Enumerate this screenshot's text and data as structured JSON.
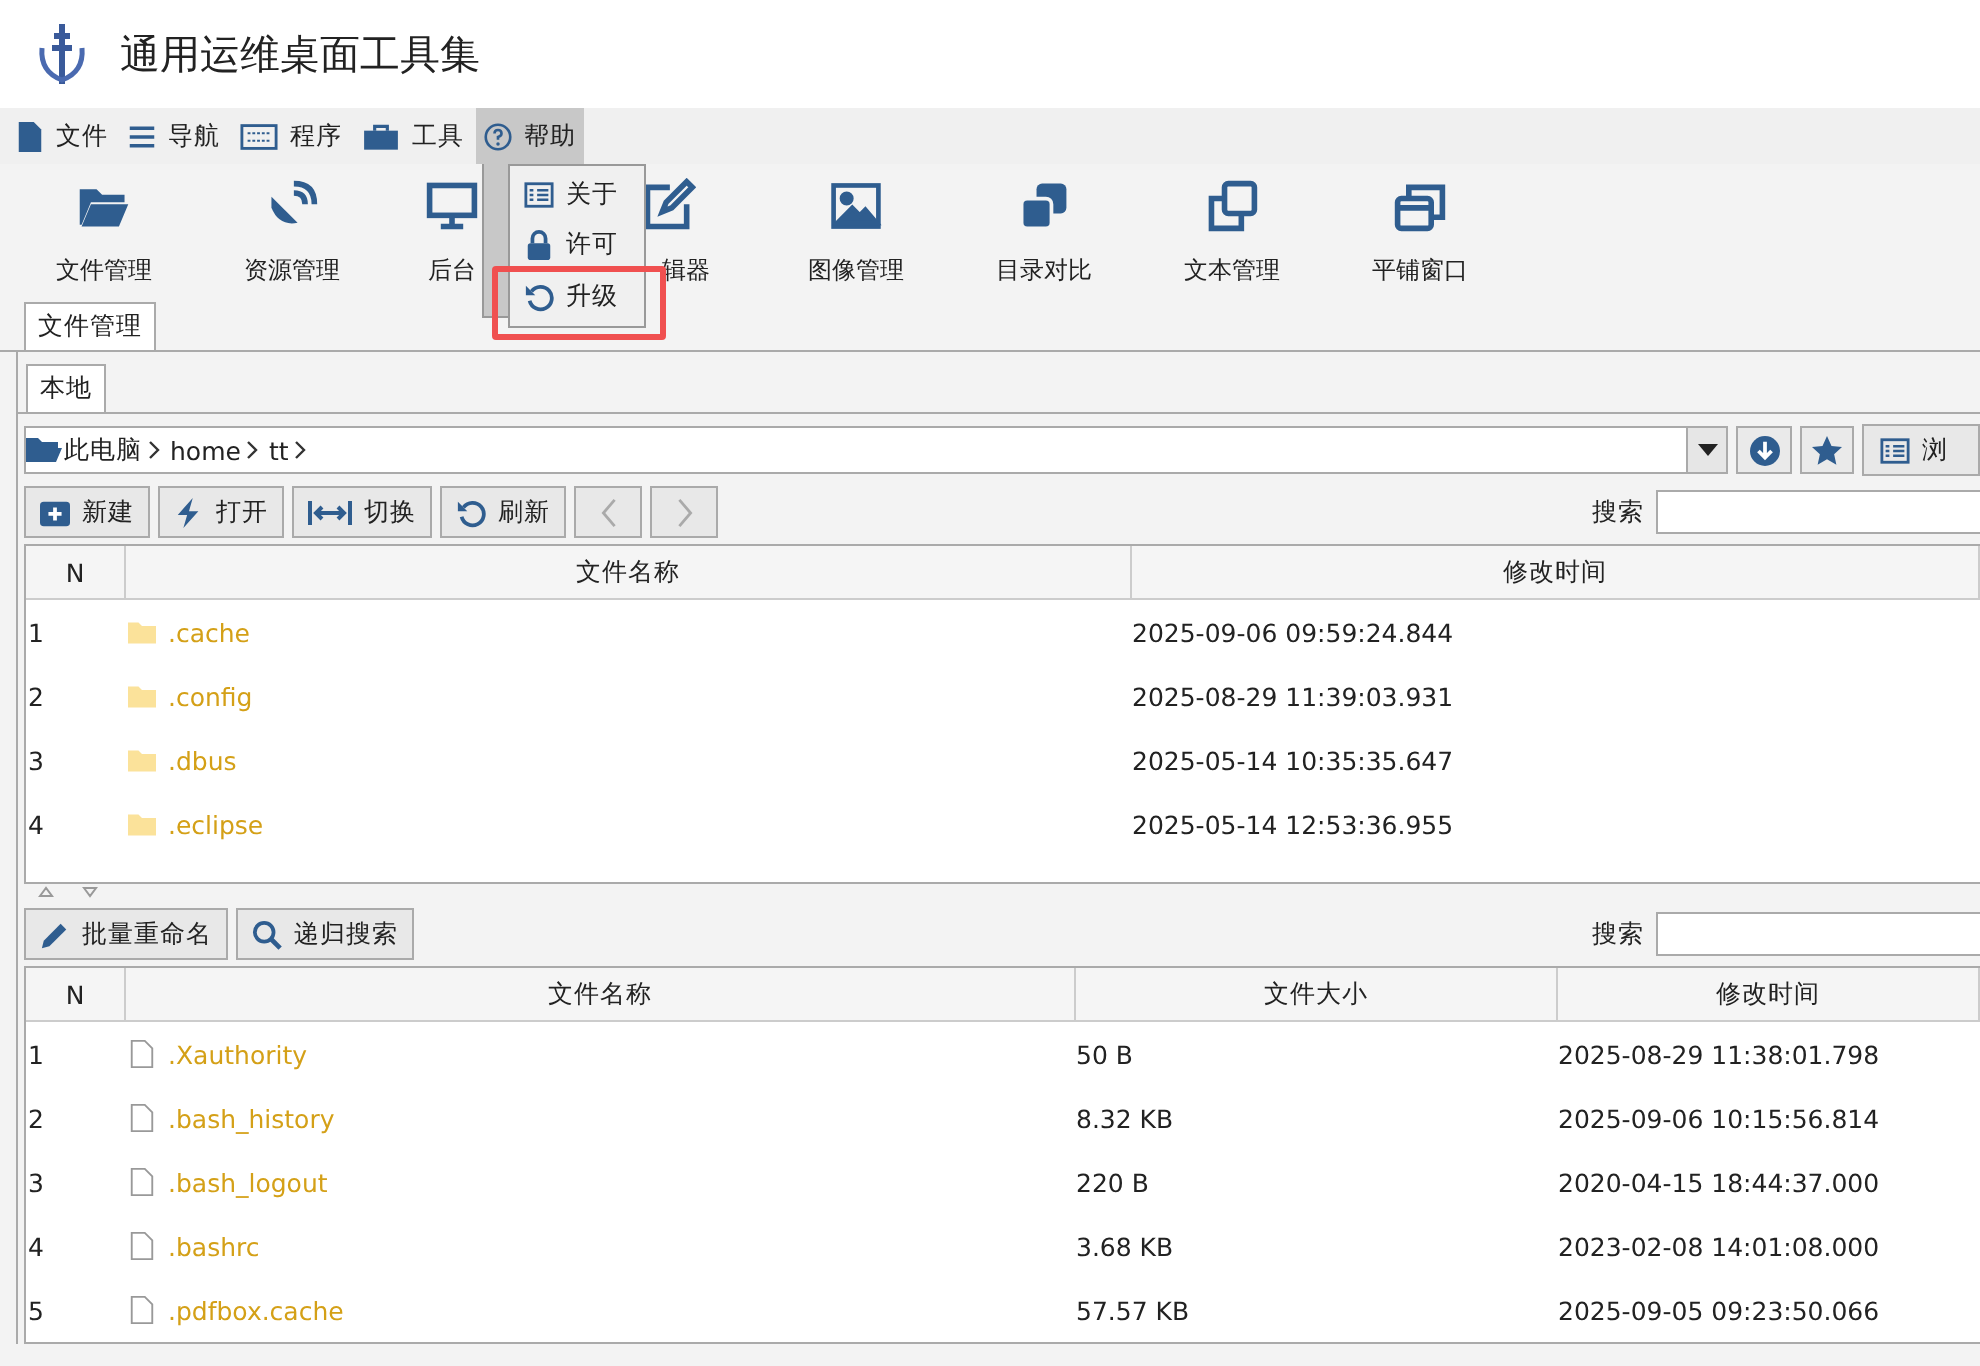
{
  "app_title": "通用运维桌面工具集",
  "menubar": [
    {
      "label": "文件",
      "selected": false
    },
    {
      "label": "导航",
      "selected": false
    },
    {
      "label": "程序",
      "selected": false
    },
    {
      "label": "工具",
      "selected": false
    },
    {
      "label": "帮助",
      "selected": true
    }
  ],
  "help_menu": [
    {
      "label": "关于",
      "annotated": false
    },
    {
      "label": "许可",
      "annotated": false
    },
    {
      "label": "升级",
      "annotated": true
    }
  ],
  "toolbar": [
    {
      "label": "文件管理",
      "kind": "whole"
    },
    {
      "label": "资源管理",
      "kind": "whole"
    },
    {
      "label": "后台",
      "kind": "tailhidden"
    },
    {
      "label": "辑器",
      "kind": "headhidden"
    },
    {
      "label": "图像管理",
      "kind": "whole"
    },
    {
      "label": "目录对比",
      "kind": "whole"
    },
    {
      "label": "文本管理",
      "kind": "whole"
    },
    {
      "label": "平铺窗口",
      "kind": "whole"
    }
  ],
  "main_tabs": [
    {
      "label": "文件管理",
      "selected": true
    }
  ],
  "sub_tabs": [
    {
      "label": "本地",
      "selected": true
    }
  ],
  "path": [
    "此电脑",
    "home",
    "tt"
  ],
  "browse_button": "浏",
  "file_buttons": [
    {
      "label": "新建",
      "disabled": false
    },
    {
      "label": "打开",
      "disabled": false
    },
    {
      "label": "切换",
      "disabled": false
    },
    {
      "label": "刷新",
      "disabled": false
    }
  ],
  "search_label": "搜索",
  "folders": {
    "columns": [
      "N",
      "文件名称",
      "修改时间"
    ],
    "rows": [
      [
        "1",
        ".cache",
        "2025-09-06 09:59:24.844"
      ],
      [
        "2",
        ".config",
        "2025-08-29 11:39:03.931"
      ],
      [
        "3",
        ".dbus",
        "2025-05-14 10:35:35.647"
      ],
      [
        "4",
        ".eclipse",
        "2025-05-14 12:53:36.955"
      ]
    ]
  },
  "bottom_buttons": [
    "批量重命名",
    "递归搜索"
  ],
  "bottom_search_label": "搜索",
  "files": {
    "columns": [
      "N",
      "文件名称",
      "文件大小",
      "修改时间"
    ],
    "rows": [
      [
        "1",
        ".Xauthority",
        "50 B",
        "2025-08-29 11:38:01.798"
      ],
      [
        "2",
        ".bash_history",
        "8.32 KB",
        "2025-09-06 10:15:56.814"
      ],
      [
        "3",
        ".bash_logout",
        "220 B",
        "2020-04-15 18:44:37.000"
      ],
      [
        "4",
        ".bashrc",
        "3.68 KB",
        "2023-02-08 14:01:08.000"
      ],
      [
        "5",
        ".pdfbox.cache",
        "57.57 KB",
        "2025-09-05 09:23:50.066"
      ]
    ]
  }
}
